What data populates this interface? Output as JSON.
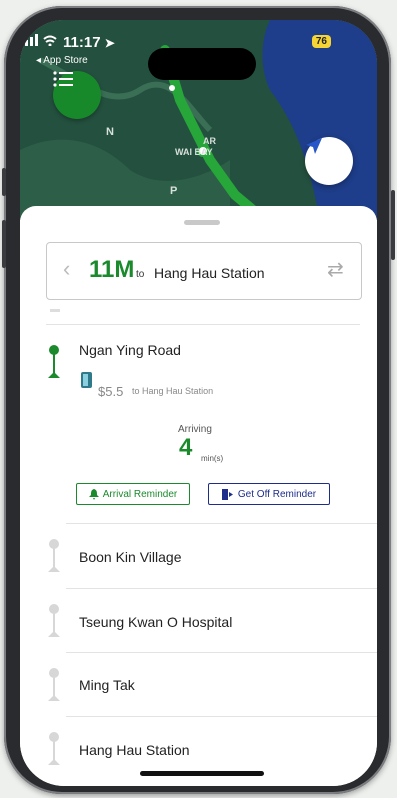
{
  "status_bar": {
    "time": "11:17",
    "back_app": "◂ App Store",
    "battery": "76"
  },
  "map": {
    "labels": [
      "N",
      "P",
      "AR",
      "WAI BAY"
    ]
  },
  "route_card": {
    "route": "11M",
    "to": "to",
    "destination": "Hang Hau Station"
  },
  "current_stop": {
    "name": "Ngan Ying Road",
    "fare": "$5.5",
    "fare_to": "to",
    "fare_destination": "Hang Hau Station",
    "arriving_label": "Arriving",
    "arriving_value": "4",
    "arriving_unit": "min(s)",
    "arrival_reminder": "Arrival Reminder",
    "get_off_reminder": "Get Off Reminder"
  },
  "stops": [
    {
      "name": "Boon Kin Village"
    },
    {
      "name": "Tseung Kwan O Hospital"
    },
    {
      "name": "Ming Tak"
    },
    {
      "name": "Hang Hau Station"
    }
  ],
  "colors": {
    "accent": "#1b8a2d",
    "blue": "#1e2d8a"
  }
}
